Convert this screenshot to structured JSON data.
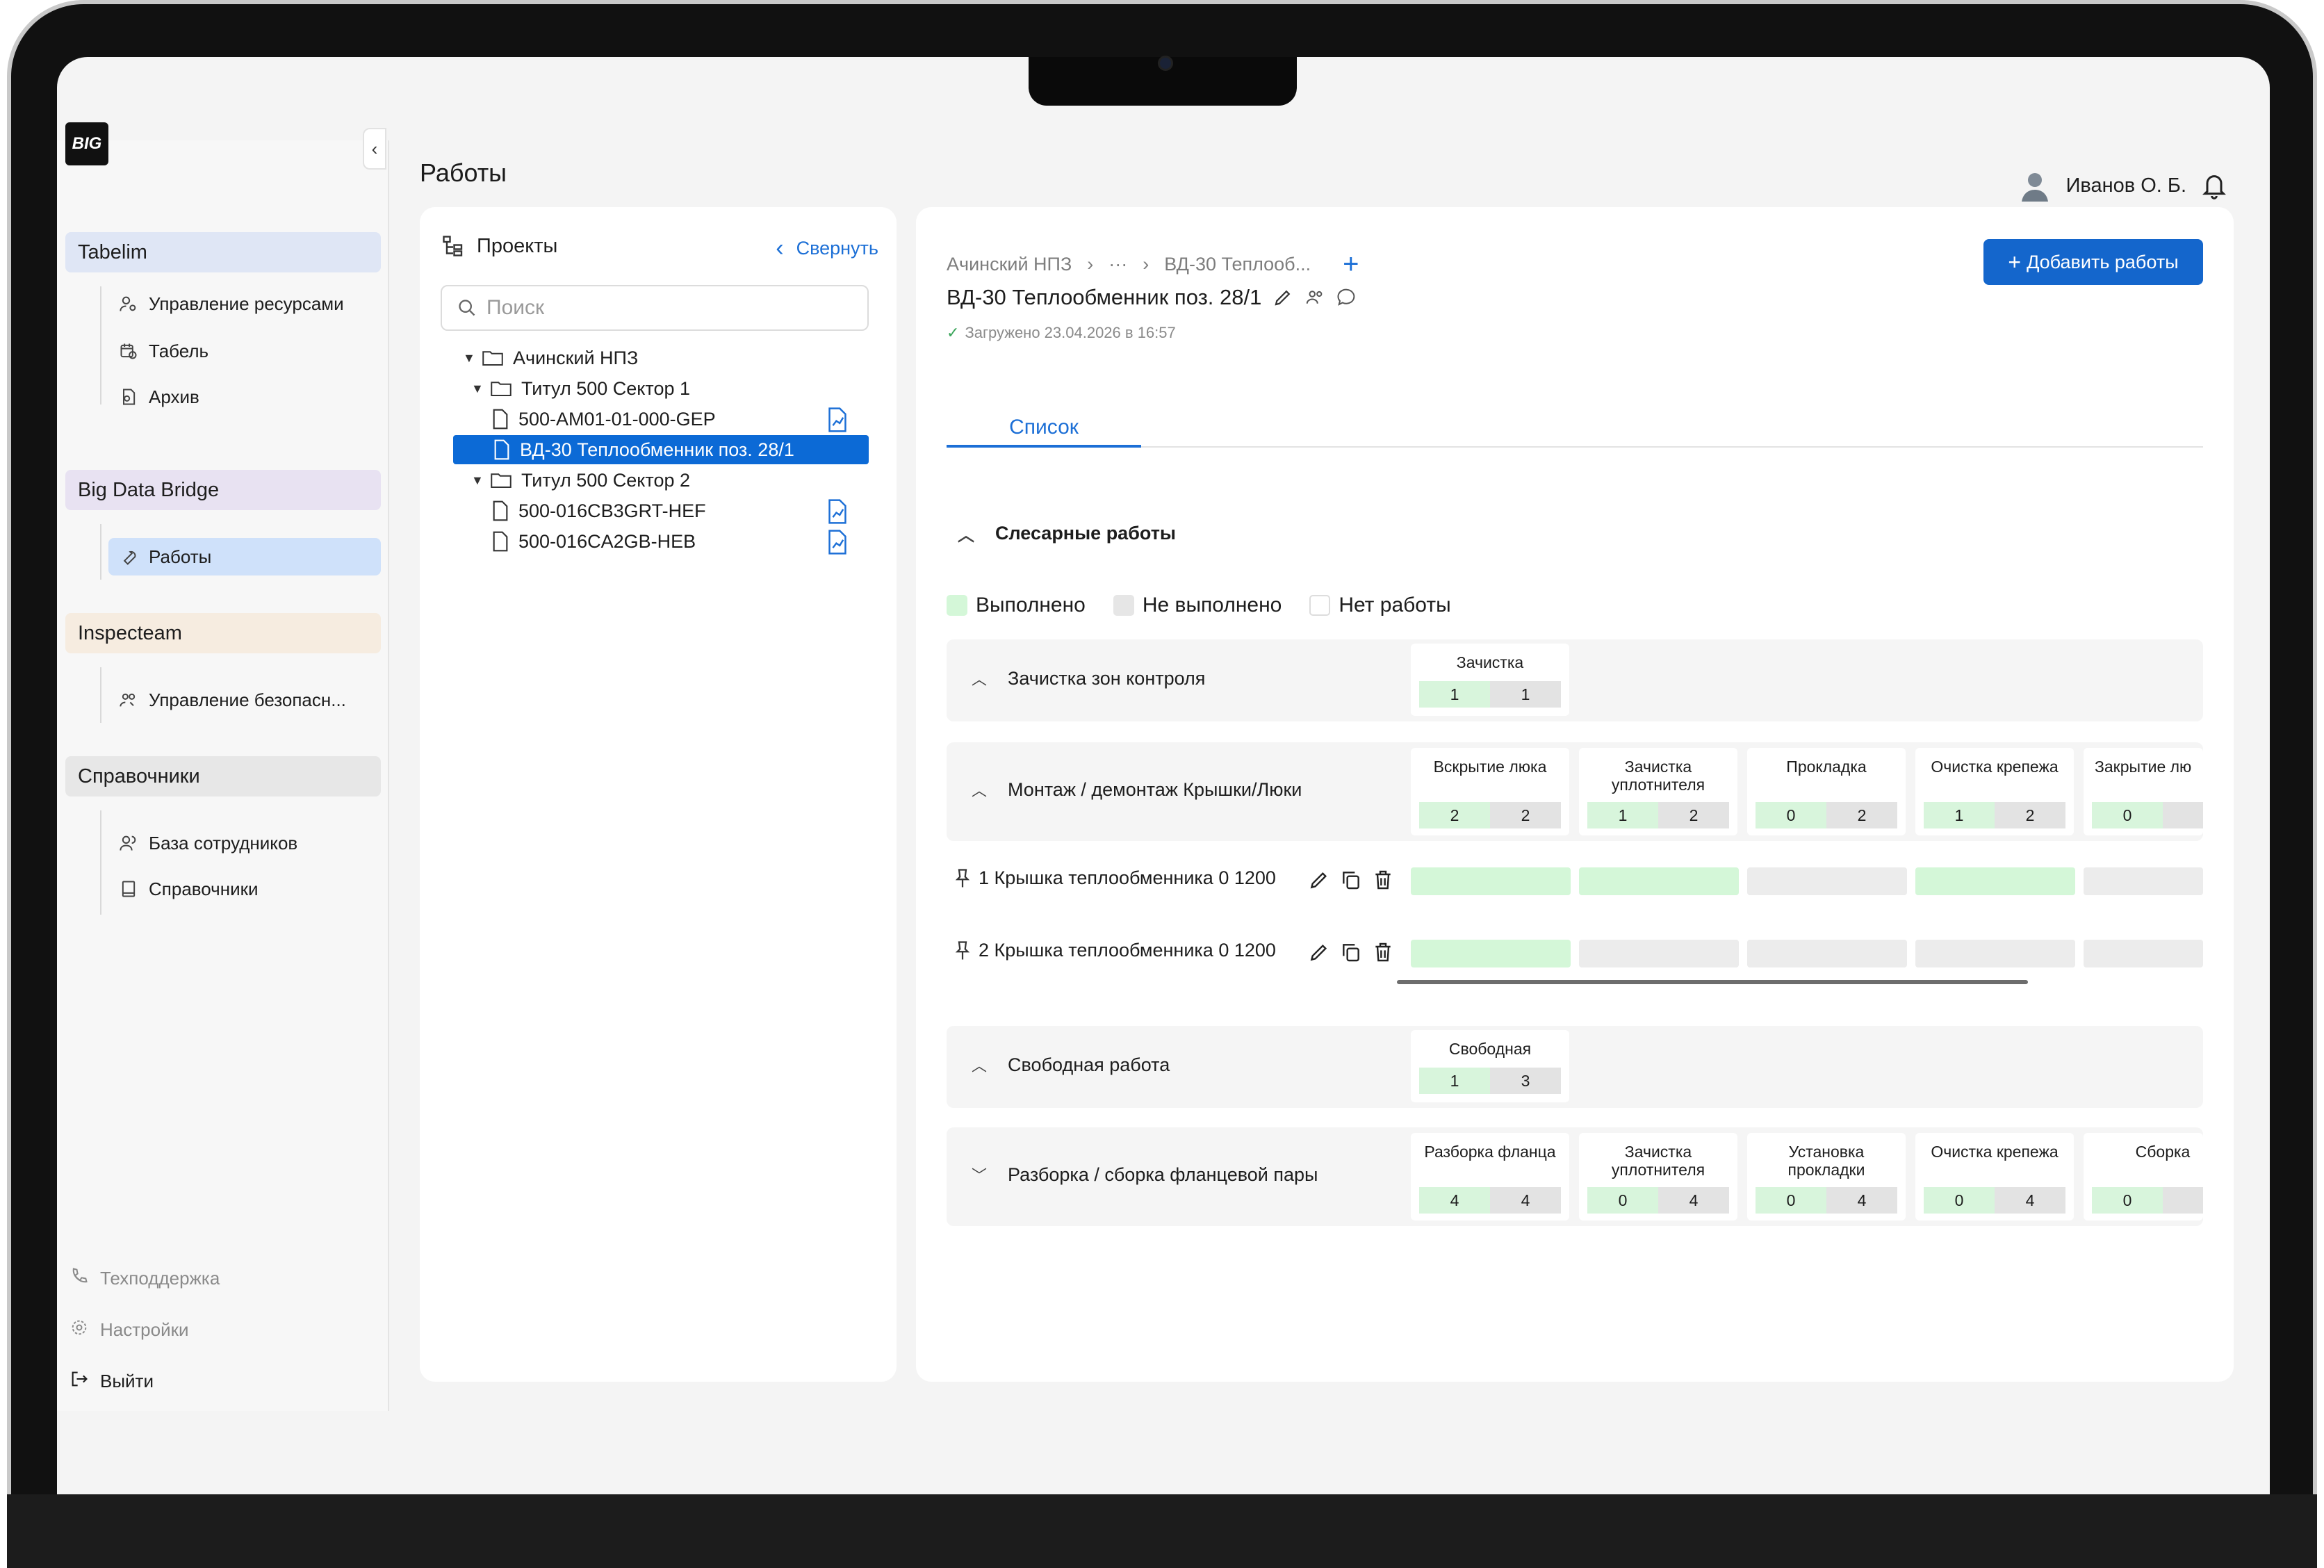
{
  "app": {
    "logo": "BIG",
    "page_title": "Работы",
    "user_name": "Иванов О. Б."
  },
  "sidebar": {
    "groups": [
      {
        "title": "Tabelim",
        "items": [
          "Управление ресурсами",
          "Табель",
          "Архив"
        ]
      },
      {
        "title": "Big Data Bridge",
        "items": [
          "Работы"
        ]
      },
      {
        "title": "Inspecteam",
        "items": [
          "Управление безопасн..."
        ]
      },
      {
        "title": "Справочники",
        "items": [
          "База сотрудников",
          "Справочники"
        ]
      }
    ],
    "footer": [
      "Техподдержка",
      "Настройки",
      "Выйти"
    ]
  },
  "projects": {
    "title": "Проекты",
    "collapse": "Свернуть",
    "search_placeholder": "Поиск",
    "tree": [
      {
        "label": "Ачинский НПЗ",
        "type": "folder"
      },
      {
        "label": "Титул 500 Сектор 1",
        "type": "folder"
      },
      {
        "label": "500-АМ01-01-000-GEP",
        "type": "file",
        "badge": true
      },
      {
        "label": "ВД-30 Теплообменник поз. 28/1",
        "type": "file",
        "selected": true
      },
      {
        "label": "Титул 500 Сектор 2",
        "type": "folder"
      },
      {
        "label": "500-016CB3GRT-HEF",
        "type": "file",
        "badge": true
      },
      {
        "label": "500-016CA2GB-HEB",
        "type": "file",
        "badge": true
      }
    ]
  },
  "main": {
    "breadcrumb": [
      "Ачинский НПЗ",
      "···",
      "ВД-30 Теплооб..."
    ],
    "title": "ВД-30 Теплообменник поз. 28/1",
    "loaded": "Загружено 23.04.2026 в 16:57",
    "add_button": "Добавить работы",
    "tab": "Список",
    "section": "Слесарные работы",
    "legend": [
      "Выполнено",
      "Не выполнено",
      "Нет работы"
    ],
    "groups": [
      {
        "name": "Зачистка зон контроля",
        "ops": [
          {
            "title": "Зачистка",
            "done": "1",
            "total": "1"
          }
        ]
      },
      {
        "name": "Монтаж / демонтаж Крышки/Люки",
        "ops": [
          {
            "title": "Вскрытие люка",
            "done": "2",
            "total": "2"
          },
          {
            "title": "Зачистка уплотнителя",
            "done": "1",
            "total": "2"
          },
          {
            "title": "Прокладка",
            "done": "0",
            "total": "2"
          },
          {
            "title": "Очистка крепежа",
            "done": "1",
            "total": "2"
          },
          {
            "title": "Закрытие лю",
            "done": "0",
            "total": ""
          }
        ]
      },
      {
        "name": "Свободная работа",
        "ops": [
          {
            "title": "Свободная",
            "done": "1",
            "total": "3"
          }
        ]
      },
      {
        "name": "Разборка / сборка фланцевой пары",
        "ops": [
          {
            "title": "Разборка фланца",
            "done": "4",
            "total": "4"
          },
          {
            "title": "Зачистка уплотнителя",
            "done": "0",
            "total": "4"
          },
          {
            "title": "Установка прокладки",
            "done": "0",
            "total": "4"
          },
          {
            "title": "Очистка крепежа",
            "done": "0",
            "total": "4"
          },
          {
            "title": "Сборка",
            "done": "0",
            "total": ""
          }
        ]
      }
    ],
    "items": [
      {
        "label": "1 Крышка теплообменника 0 1200",
        "states": [
          "done",
          "done",
          "none",
          "done",
          "none"
        ]
      },
      {
        "label": "2 Крышка теплообменника 0 1200",
        "states": [
          "done",
          "none",
          "none",
          "none",
          "none"
        ]
      }
    ],
    "colors": {
      "done": "#d4f7d8",
      "none": "#ececec",
      "accent": "#1466cc"
    }
  }
}
